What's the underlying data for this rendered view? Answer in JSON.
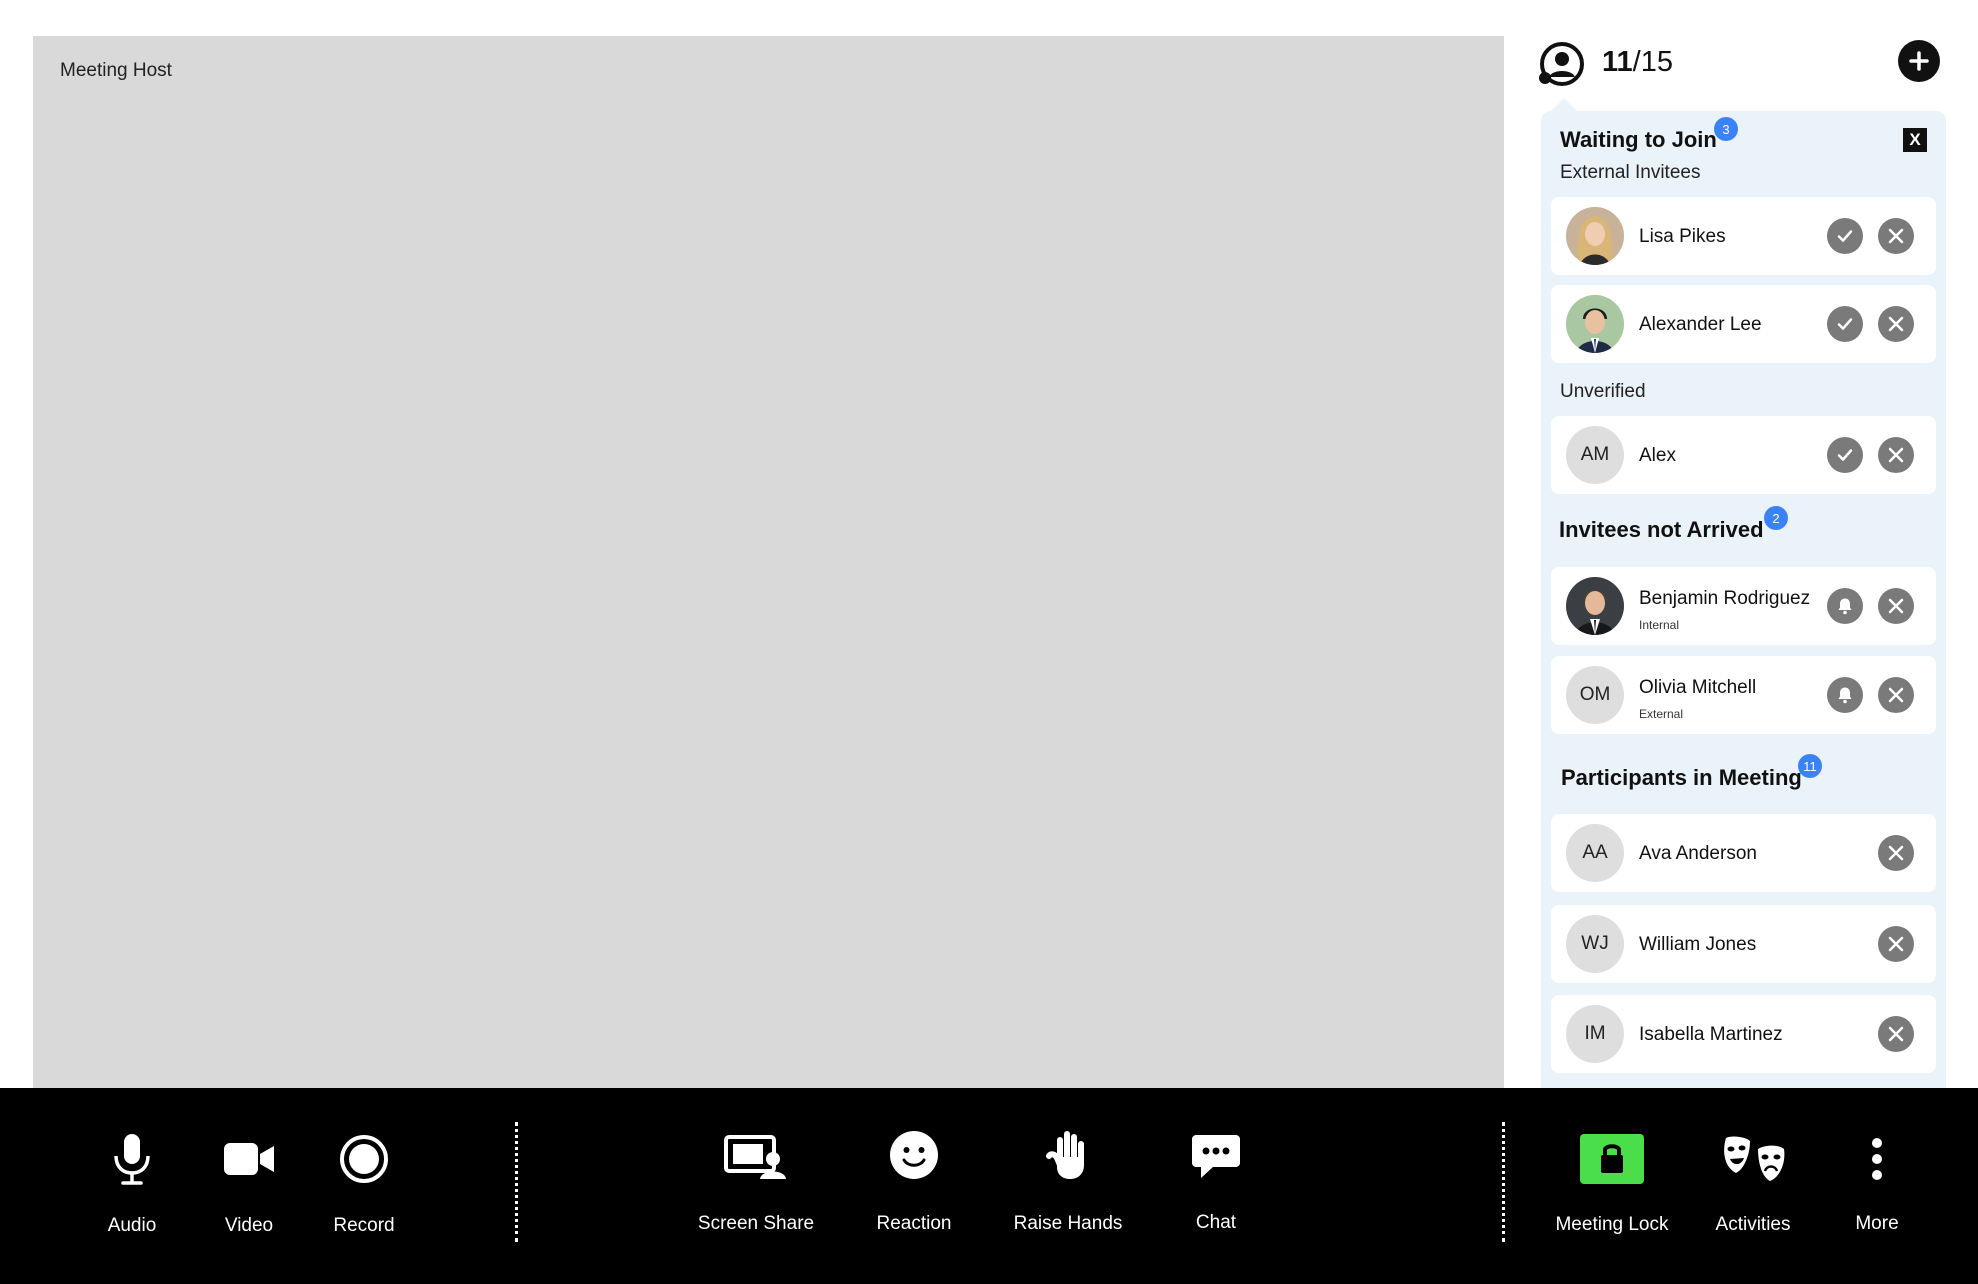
{
  "stage": {
    "label": "Meeting Host"
  },
  "header": {
    "count_current": "11",
    "count_sep_total": "/15"
  },
  "waiting": {
    "title": "Waiting to Join",
    "badge": "3",
    "close_label": "X",
    "external_label": "External Invitees",
    "unverified_label": "Unverified",
    "external": [
      {
        "name": "Lisa Pikes"
      },
      {
        "name": "Alexander Lee"
      }
    ],
    "unverified": [
      {
        "initials": "AM",
        "name": "Alex"
      }
    ]
  },
  "not_arrived": {
    "title": "Invitees not Arrived",
    "badge": "2",
    "items": [
      {
        "name": "Benjamin Rodriguez",
        "role": "Internal"
      },
      {
        "initials": "OM",
        "name": "Olivia Mitchell",
        "role": "External"
      }
    ]
  },
  "participants": {
    "title": "Participants in Meeting",
    "badge": "11",
    "items": [
      {
        "initials": "AA",
        "name": "Ava Anderson"
      },
      {
        "initials": "WJ",
        "name": "William Jones"
      },
      {
        "initials": "IM",
        "name": "Isabella Martinez"
      }
    ]
  },
  "toolbar": {
    "audio": "Audio",
    "video": "Video",
    "record": "Record",
    "screen_share": "Screen Share",
    "reaction": "Reaction",
    "raise_hands": "Raise Hands",
    "chat": "Chat",
    "meeting_lock": "Meeting Lock",
    "activities": "Activities",
    "more": "More"
  },
  "colors": {
    "panel_bg": "#eaf3fa",
    "badge": "#3b82f6",
    "lock_green": "#4ade4a",
    "action_grey": "#7a7a7a",
    "stage_bg": "#d9d9d9"
  },
  "icons": {
    "header": [
      "participants-icon",
      "add-icon"
    ],
    "actions": [
      "check-icon",
      "close-icon",
      "bell-icon"
    ],
    "toolbar": [
      "microphone-icon",
      "video-camera-icon",
      "record-icon",
      "screen-share-icon",
      "smiley-icon",
      "hand-icon",
      "chat-bubble-icon",
      "lock-icon",
      "theater-masks-icon",
      "more-vertical-icon"
    ]
  }
}
